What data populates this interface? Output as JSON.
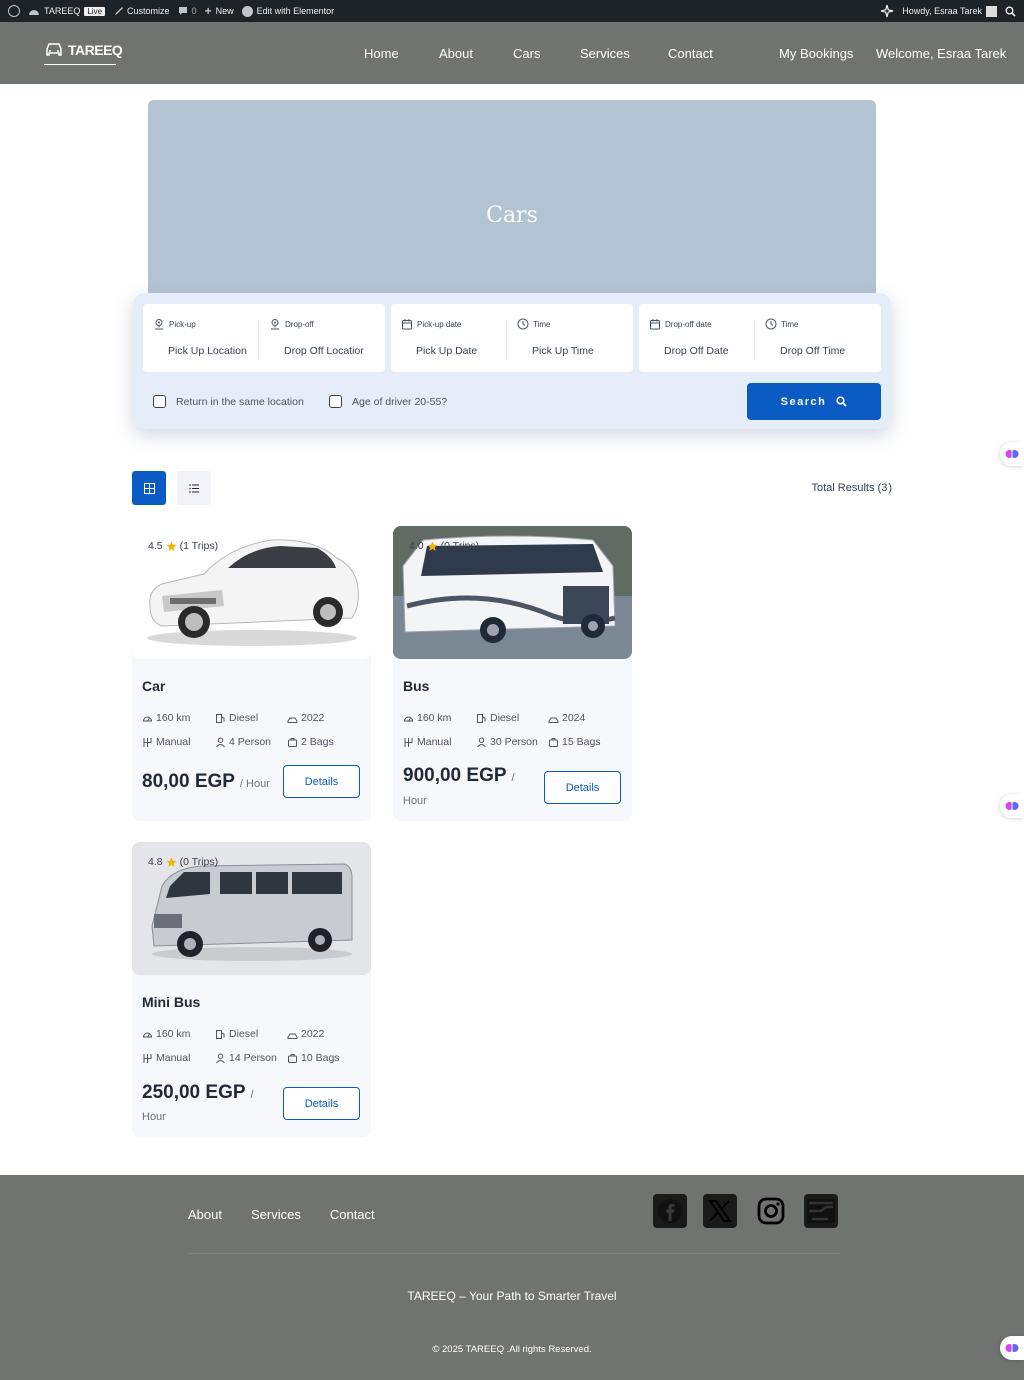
{
  "admin_bar": {
    "site_name": "TAREEQ",
    "live_badge": "Live",
    "customize": "Customize",
    "comments_count": "0",
    "new_label": "New",
    "elementor": "Edit with Elementor",
    "howdy": "Howdy, Esraa Tarek"
  },
  "header": {
    "logo": "TAREEQ",
    "nav": [
      "Home",
      "About",
      "Cars",
      "Services",
      "Contact"
    ],
    "my_bookings": "My Bookings",
    "welcome": "Welcome, Esraa Tarek"
  },
  "hero": {
    "title": "Cars"
  },
  "search": {
    "fields": [
      {
        "label": "Pick-up",
        "value": "Pick Up Location",
        "icon": "location-pin-icon"
      },
      {
        "label": "Drop-off",
        "value": "Drop Off Locatior",
        "icon": "location-pin-icon"
      },
      {
        "label": "Pick-up date",
        "value": "Pick Up Date",
        "icon": "calendar-icon"
      },
      {
        "label": "Time",
        "value": "Pick Up Time",
        "icon": "clock-icon"
      },
      {
        "label": "Drop-off date",
        "value": "Drop Off Date",
        "icon": "calendar-icon"
      },
      {
        "label": "Time",
        "value": "Drop Off Time",
        "icon": "clock-icon"
      }
    ],
    "same_location": "Return in the same location",
    "driver_age": "Age of driver 20-55?",
    "button": "Search"
  },
  "results": {
    "total_label": "Total Results",
    "total": "3"
  },
  "cars": [
    {
      "rating": "4.5",
      "trips": "(1 Trips)",
      "title": "Car",
      "mileage": "160 km",
      "fuel": "Diesel",
      "year": "2022",
      "transmission": "Manual",
      "seats": "4 Person",
      "bags": "2 Bags",
      "price": "80,00 EGP",
      "unit": "/ Hour",
      "button": "Details"
    },
    {
      "rating": "4.0",
      "trips": "(0 Trips)",
      "title": "Bus",
      "mileage": "160 km",
      "fuel": "Diesel",
      "year": "2024",
      "transmission": "Manual",
      "seats": "30 Person",
      "bags": "15 Bags",
      "price": "900,00 EGP",
      "unit_slash": "/",
      "unit_word": "Hour",
      "button": "Details"
    },
    {
      "rating": "4.8",
      "trips": "(0 Trips)",
      "title": "Mini Bus",
      "mileage": "160 km",
      "fuel": "Diesel",
      "year": "2022",
      "transmission": "Manual",
      "seats": "14 Person",
      "bags": "10 Bags",
      "price": "250,00 EGP",
      "unit_slash": "/",
      "unit_word": "Hour",
      "button": "Details"
    }
  ],
  "footer": {
    "links": [
      "About",
      "Services",
      "Contact"
    ],
    "social": [
      "facebook-icon",
      "x-icon",
      "instagram-icon",
      "mail-icon"
    ],
    "tagline": "TAREEQ – Your Path to Smarter Travel",
    "copyright": "© 2025 TAREEQ .All rights Reserved."
  },
  "colors": {
    "accent": "#0a5cc4",
    "header_bg": "#6f7471",
    "hero_bg": "#b4c3d1",
    "search_bg": "#e4edf8",
    "star": "#f5b301"
  }
}
